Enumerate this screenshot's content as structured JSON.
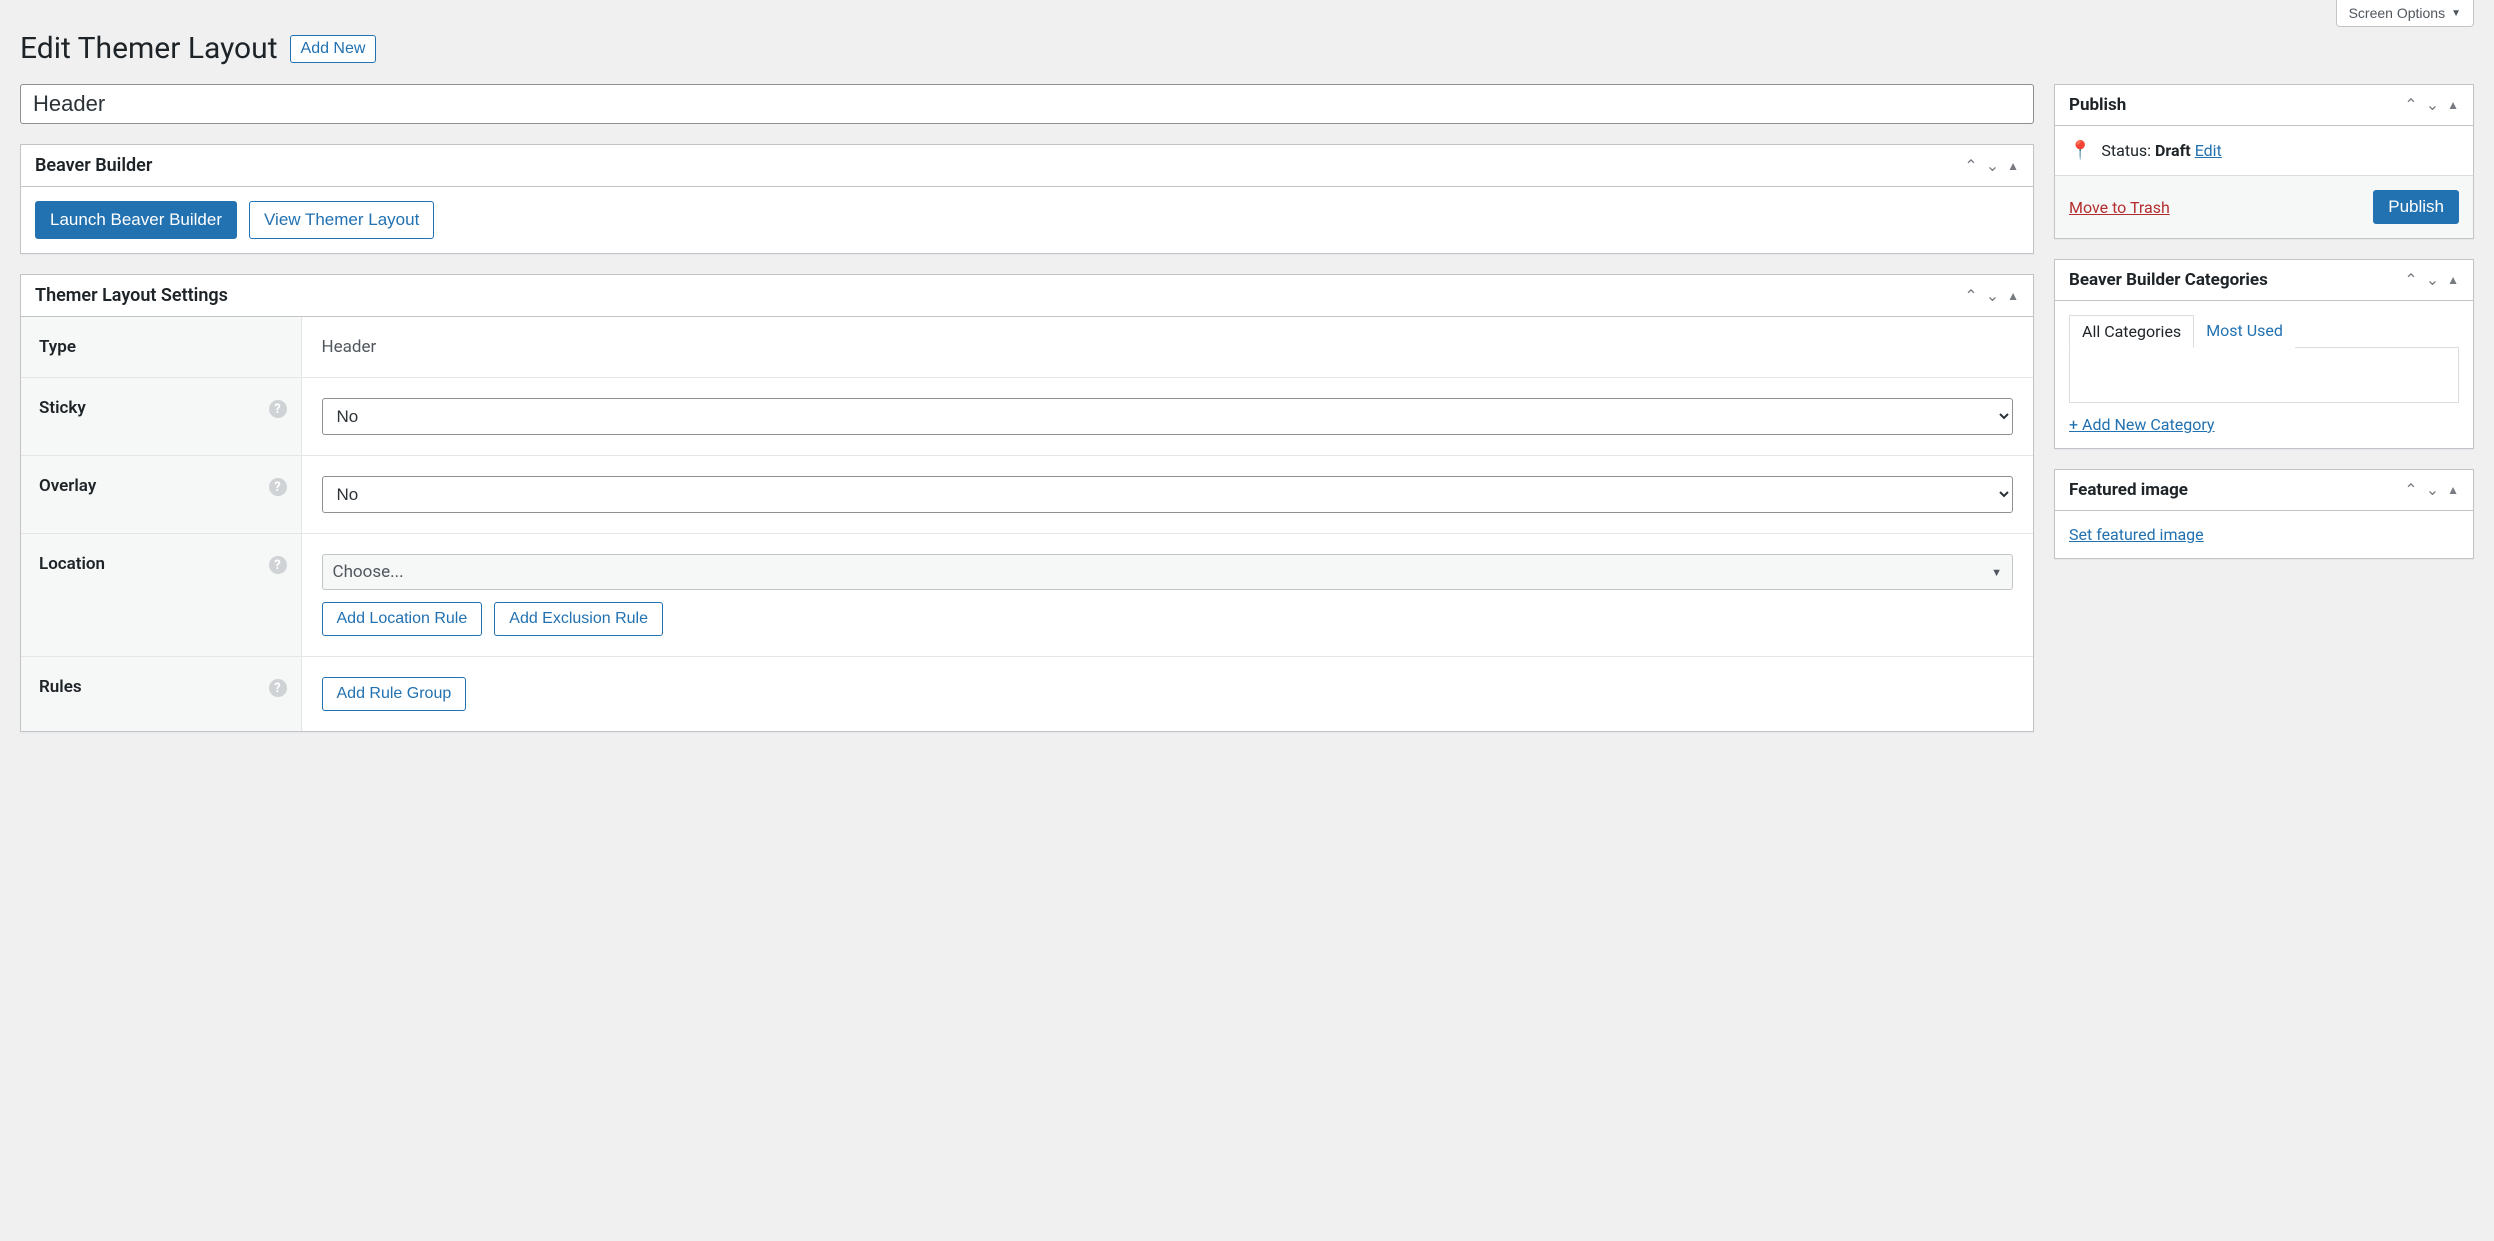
{
  "screenOptions": {
    "label": "Screen Options"
  },
  "heading": {
    "title": "Edit Themer Layout",
    "addNew": "Add New"
  },
  "titleInput": {
    "value": "Header"
  },
  "beaverBuilder": {
    "panelTitle": "Beaver Builder",
    "launchBtn": "Launch Beaver Builder",
    "viewBtn": "View Themer Layout"
  },
  "settings": {
    "panelTitle": "Themer Layout Settings",
    "rows": {
      "type": {
        "label": "Type",
        "value": "Header"
      },
      "sticky": {
        "label": "Sticky",
        "value": "No"
      },
      "overlay": {
        "label": "Overlay",
        "value": "No"
      },
      "location": {
        "label": "Location",
        "choose": "Choose...",
        "addLocation": "Add Location Rule",
        "addExclusion": "Add Exclusion Rule"
      },
      "rules": {
        "label": "Rules",
        "addRuleGroup": "Add Rule Group"
      }
    }
  },
  "publish": {
    "panelTitle": "Publish",
    "statusLabel": "Status: ",
    "statusValue": "Draft",
    "editLink": "Edit",
    "trashLink": "Move to Trash",
    "publishBtn": "Publish"
  },
  "categories": {
    "panelTitle": "Beaver Builder Categories",
    "tabAll": "All Categories",
    "tabMost": "Most Used",
    "addNew": "+ Add New Category"
  },
  "featured": {
    "panelTitle": "Featured image",
    "setLink": "Set featured image"
  }
}
